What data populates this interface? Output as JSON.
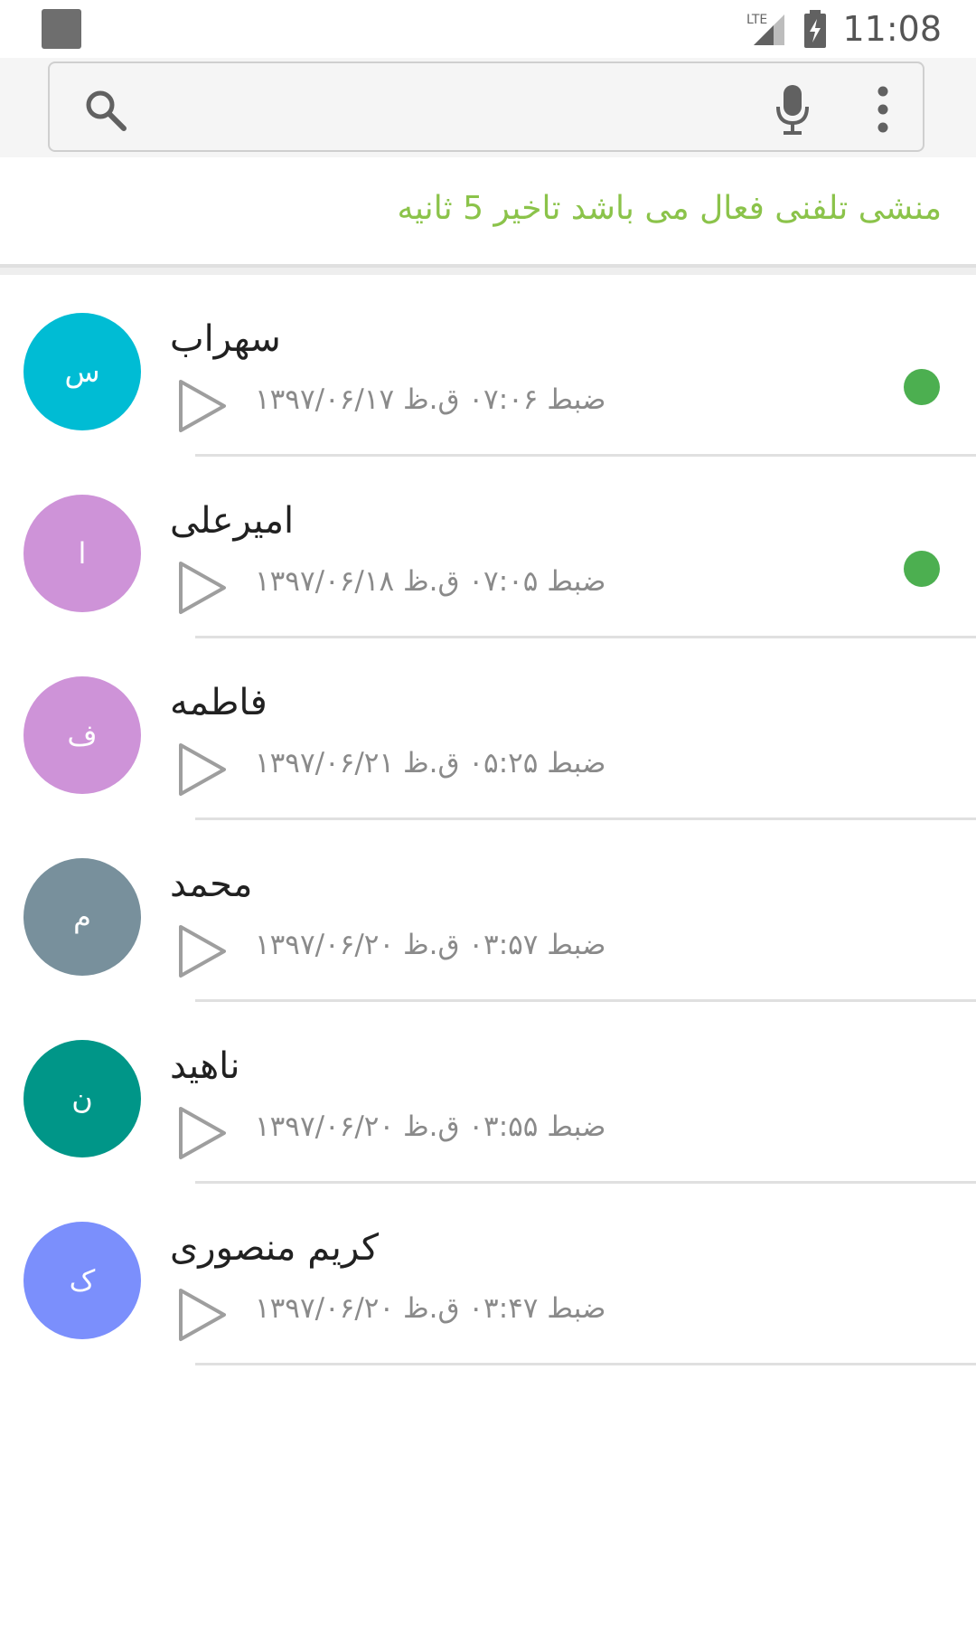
{
  "status_bar": {
    "time": "11:08",
    "network_label": "LTE"
  },
  "search": {
    "value": "",
    "placeholder": ""
  },
  "banner": {
    "text": "منشی تلفنی فعال می باشد تاخیر 5 ثانیه",
    "color": "#8bc34a"
  },
  "recordings": [
    {
      "name": "سهراب",
      "initial": "س",
      "avatar_color": "#00bcd4",
      "meta": "ضبط ۰۷:۰۶ ق.ظ ۱۳۹۷/۰۶/۱۷",
      "unread": true
    },
    {
      "name": "امیرعلی",
      "initial": "ا",
      "avatar_color": "#ce93d8",
      "meta": "ضبط ۰۷:۰۵ ق.ظ ۱۳۹۷/۰۶/۱۸",
      "unread": true
    },
    {
      "name": "فاطمه",
      "initial": "ف",
      "avatar_color": "#ce93d8",
      "meta": "ضبط ۰۵:۲۵ ق.ظ ۱۳۹۷/۰۶/۲۱",
      "unread": false
    },
    {
      "name": "محمد",
      "initial": "م",
      "avatar_color": "#78909c",
      "meta": "ضبط ۰۳:۵۷ ق.ظ ۱۳۹۷/۰۶/۲۰",
      "unread": false
    },
    {
      "name": "ناهید",
      "initial": "ن",
      "avatar_color": "#009688",
      "meta": "ضبط ۰۳:۵۵ ق.ظ ۱۳۹۷/۰۶/۲۰",
      "unread": false
    },
    {
      "name": "کریم منصوری",
      "initial": "ک",
      "avatar_color": "#7b8ffc",
      "meta": "ضبط ۰۳:۴۷ ق.ظ ۱۳۹۷/۰۶/۲۰",
      "unread": false
    }
  ],
  "colors": {
    "unread_dot": "#4caf50",
    "icon_gray": "#757575"
  },
  "icons": {
    "search": "search-icon",
    "mic": "mic-icon",
    "more": "more-vert-icon",
    "play": "play-icon",
    "battery": "battery-charging-icon",
    "signal": "signal-icon"
  }
}
